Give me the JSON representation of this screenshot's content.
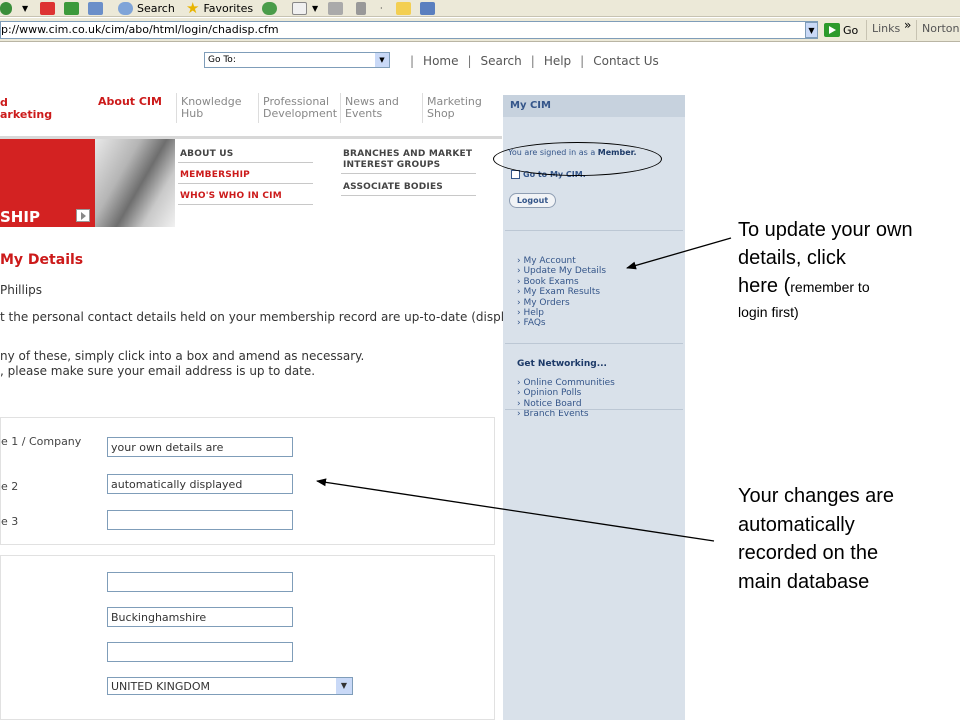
{
  "browser": {
    "toolbar": {
      "search_label": "Search",
      "favorites_label": "Favorites"
    },
    "address": {
      "url": "p://www.cim.co.uk/cim/abo/html/login/chadisp.cfm",
      "go_label": "Go",
      "links_label": "Links",
      "chevron": "»",
      "norton_label": "Norton"
    }
  },
  "site": {
    "goto_select": "Go To:",
    "topnav": [
      "Home",
      "Search",
      "Help",
      "Contact Us"
    ],
    "brand_line1": "d",
    "brand_line2": "arketing",
    "mainnav": [
      {
        "line1": "About CIM",
        "line2": ""
      },
      {
        "line1": "Knowledge",
        "line2": "Hub"
      },
      {
        "line1": "Professional",
        "line2": "Development"
      },
      {
        "line1": "News and",
        "line2": "Events"
      },
      {
        "line1": "Marketing",
        "line2": "Shop"
      }
    ],
    "banner_text": "SHIP",
    "sublinks_left": [
      "ABOUT US",
      "MEMBERSHIP",
      "WHO'S WHO IN CIM"
    ],
    "sublinks_right": [
      "BRANCHES AND MARKET",
      "INTEREST GROUPS",
      "ASSOCIATE BODIES"
    ],
    "section_title": "My Details",
    "name_text": "Phillips",
    "intro_text": "t the personal contact details held on your membership record are up-to-date (displayed",
    "instr_line1": "ny of these, simply click into a box and amend as necessary.",
    "instr_line2": ", please make sure your email address is up to date.",
    "form1": {
      "labels": [
        "e 1 / Company",
        "e 2",
        "e 3"
      ],
      "values": [
        "your own details are",
        "automatically displayed",
        ""
      ]
    },
    "form2": {
      "values": [
        "",
        "Buckinghamshire",
        ""
      ],
      "country": "UNITED KINGDOM"
    }
  },
  "sidebar": {
    "title": "My CIM",
    "signed_in_prefix": "You are signed in as a",
    "signed_in_role": "Member.",
    "goto_mycim": "Go to My CIM.",
    "logout": "Logout",
    "menu": [
      "My Account",
      "Update My Details",
      "Book Exams",
      "My Exam Results",
      "My Orders",
      "Help",
      "FAQs"
    ],
    "networking_heading": "Get Networking...",
    "networking_menu": [
      "Online Communities",
      "Opinion Polls",
      "Notice Board",
      "Branch Events"
    ]
  },
  "annotations": {
    "note1_line1": "To update your own",
    "note1_line2": "details, click",
    "note1_line3a": "here (",
    "note1_line3b": "remember to",
    "note1_line4": "login first)",
    "note2_line1": "Your changes are",
    "note2_line2": "automatically",
    "note2_line3": "recorded on the",
    "note2_line4": "main database"
  }
}
